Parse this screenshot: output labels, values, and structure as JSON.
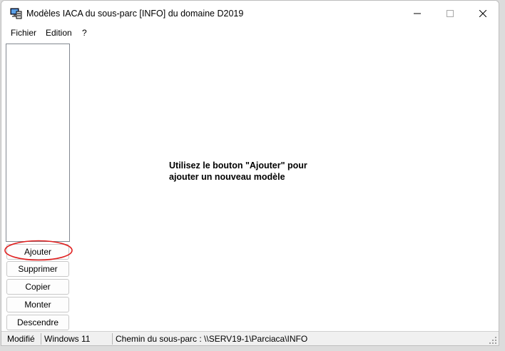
{
  "window": {
    "title": "Modèles IACA du sous-parc [INFO] du domaine D2019",
    "app_icon": "monitor-icon",
    "controls": [
      "minimize-icon",
      "maximize-icon",
      "close-icon"
    ]
  },
  "menu": {
    "fichier": "Fichier",
    "edition": "Edition",
    "help": "?"
  },
  "buttons": {
    "ajouter": "Ajouter",
    "supprimer": "Supprimer",
    "copier": "Copier",
    "monter": "Monter",
    "descendre": "Descendre"
  },
  "message": {
    "line1": "Utilisez le bouton \"Ajouter\" pour",
    "line2": "ajouter un nouveau modèle"
  },
  "status": {
    "state": "Modifié",
    "os": "Windows 11",
    "path": "Chemin du sous-parc : \\\\SERV19-1\\Parciaca\\INFO"
  },
  "colors": {
    "highlight": "#e02020",
    "window_bg": "#ffffff",
    "statusbar_bg": "#f0f0f0"
  }
}
